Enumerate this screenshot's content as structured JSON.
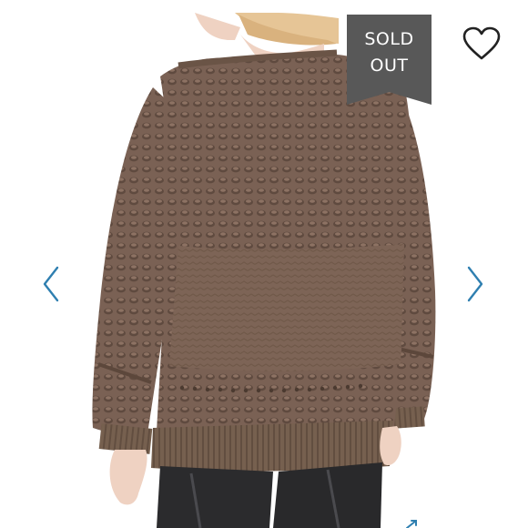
{
  "badge": {
    "line1": "SOLD",
    "line2": "OUT"
  },
  "icons": {
    "like": "heart-outline-icon",
    "previous": "chevron-left-icon",
    "next": "chevron-right-icon",
    "expand": "expand-arrow-icon"
  },
  "colors": {
    "badge_bg": "#585858",
    "nav_arrow": "#2f7fb0",
    "sweater": "#7a6154",
    "pants": "#2b2b2d",
    "hair": "#e7c9a0",
    "skin": "#efd2c2"
  }
}
